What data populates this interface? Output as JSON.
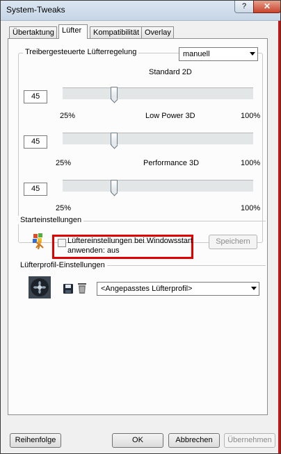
{
  "window": {
    "title": "System-Tweaks",
    "help_label": "?",
    "close_label": "✕"
  },
  "tabs": [
    {
      "label": "Übertaktung"
    },
    {
      "label": "Lüfter"
    },
    {
      "label": "Kompatibilität"
    },
    {
      "label": "Overlay"
    }
  ],
  "fan_group": {
    "label": "Treibergesteuerte Lüfterregelung",
    "mode": "manuell",
    "sliders": [
      {
        "title": "Standard 2D",
        "value": "45",
        "min_label": "25%",
        "max_label": "100%"
      },
      {
        "title": "Low Power 3D",
        "value": "45",
        "min_label": "25%",
        "max_label": "100%"
      },
      {
        "title": "Performance 3D",
        "value": "45",
        "min_label": "25%",
        "max_label": "100%"
      }
    ]
  },
  "startup_group": {
    "label": "Starteinstellungen",
    "checkbox_label_line1": "Lüftereinstellungen bei Windowsstart",
    "checkbox_label_line2": "anwenden:  aus",
    "checked": false,
    "save_label": "Speichern"
  },
  "profile_group": {
    "label": "Lüfterprofil-Einstellungen",
    "selected_profile": "<Angepasstes Lüfterprofil>"
  },
  "footer": {
    "order_label": "Reihenfolge",
    "ok_label": "OK",
    "cancel_label": "Abbrechen",
    "apply_label": "Übernehmen"
  },
  "colors": {
    "highlight_border": "#e00000"
  }
}
